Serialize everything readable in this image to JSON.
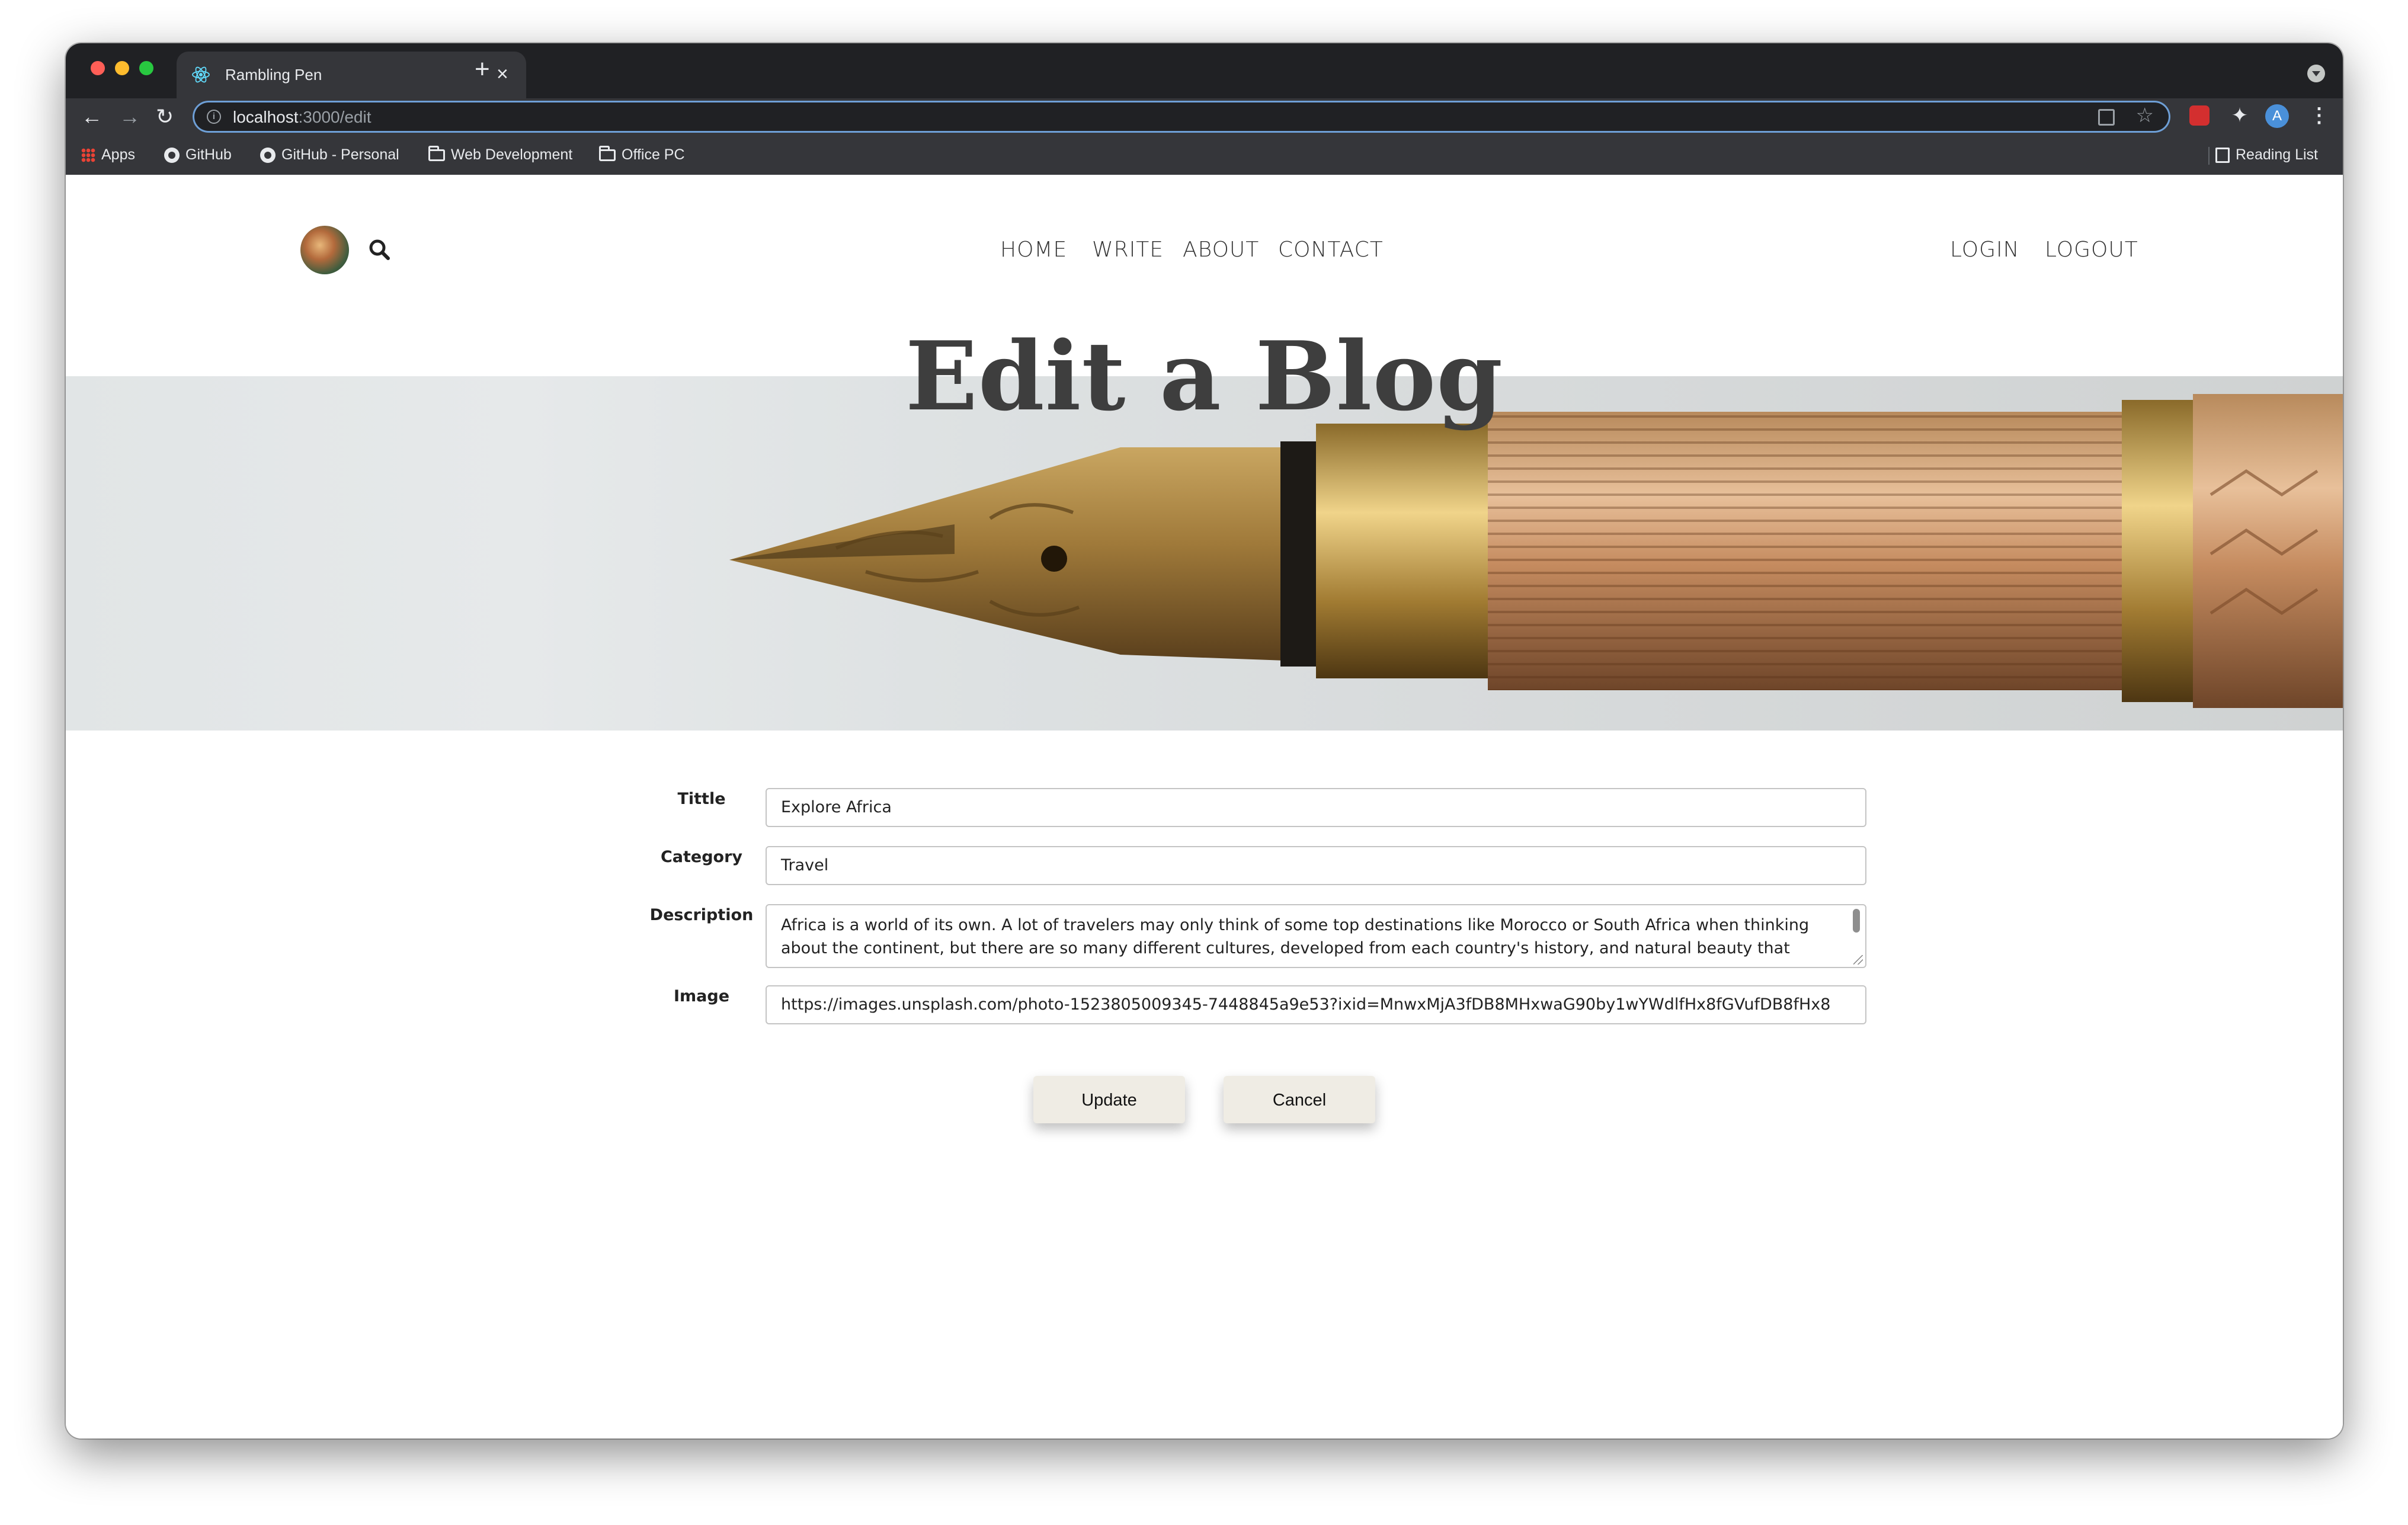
{
  "browser": {
    "tab_title": "Rambling Pen",
    "url_host": "localhost",
    "url_path": ":3000/edit",
    "profile_initial": "A",
    "bookmarks": [
      "Apps",
      "GitHub",
      "GitHub - Personal",
      "Web Development",
      "Office PC"
    ],
    "reading_list": "Reading List"
  },
  "nav": {
    "home": "HOME",
    "write": "WRITE",
    "about": "ABOUT",
    "contact": "CONTACT",
    "login": "LOGIN",
    "logout": "LOGOUT"
  },
  "hero": {
    "heading": "Edit a Blog"
  },
  "form": {
    "title_label": "Tittle",
    "title_value": "Explore Africa",
    "category_label": "Category",
    "category_value": "Travel",
    "description_label": "Description",
    "description_value": "Africa is a world of its own. A lot of travelers may only think of some top destinations like Morocco or South Africa when thinking about the continent, but there are so many different cultures, developed from each country's history, and natural beauty that you",
    "image_label": "Image",
    "image_value": "https://images.unsplash.com/photo-1523805009345-7448845a9e53?ixid=MnwxMjA3fDB8MHxwaG90by1wYWdlfHx8fGVufDB8fHx8",
    "update_label": "Update",
    "cancel_label": "Cancel"
  }
}
